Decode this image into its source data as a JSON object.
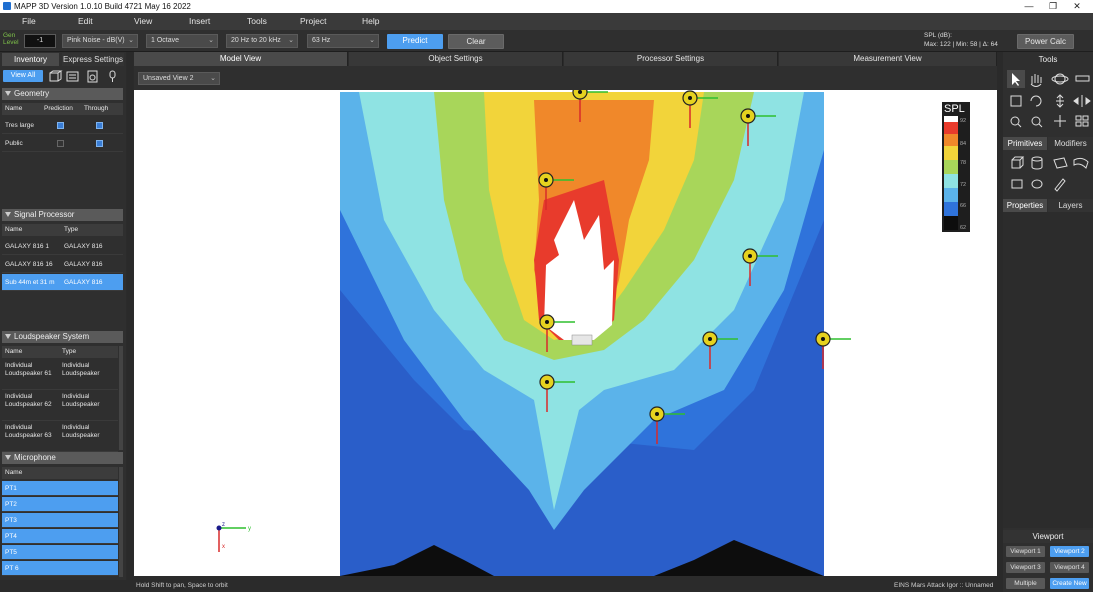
{
  "window": {
    "title": "MAPP 3D Version 1.0.10 Build 4721 May 16 2022",
    "min": "—",
    "restore": "❐",
    "close": "✕"
  },
  "menu": [
    "File",
    "Edit",
    "View",
    "Insert",
    "Tools",
    "Project",
    "Help"
  ],
  "toolbar": {
    "gen_label": "Gen\nLevel",
    "gen_value": "-1",
    "signal": "Pink Noise - dB(V)",
    "octave": "1 Octave",
    "range": "20 Hz to 20 kHz",
    "freq": "63 Hz",
    "predict": "Predict",
    "clear": "Clear",
    "spl_label": "SPL (dB):",
    "spl_stats": "Max: 122 | Min: 58 | Δ: 64",
    "power_calc": "Power Calc"
  },
  "left": {
    "tabs": [
      "Inventory",
      "Express Settings"
    ],
    "view_all": "View All",
    "geometry": {
      "title": "Geometry",
      "headers": [
        "Name",
        "Prediction",
        "Through"
      ],
      "rows": [
        {
          "name": "Tres large",
          "prediction": true,
          "through": true
        },
        {
          "name": "Public",
          "prediction": false,
          "through": true
        }
      ]
    },
    "signal_processor": {
      "title": "Signal Processor",
      "headers": [
        "Name",
        "Type"
      ],
      "rows": [
        {
          "name": "GALAXY 816 1",
          "type": "GALAXY 816"
        },
        {
          "name": "GALAXY 816 16",
          "type": "GALAXY 816"
        },
        {
          "name": "Sub 44m et 31 m",
          "type": "GALAXY 816"
        }
      ]
    },
    "loudspeaker": {
      "title": "Loudspeaker System",
      "headers": [
        "Name",
        "Type"
      ],
      "rows": [
        {
          "name1": "Individual",
          "name2": "Loudspeaker 61",
          "type1": "Individual",
          "type2": "Loudspeaker"
        },
        {
          "name1": "Individual",
          "name2": "Loudspeaker 62",
          "type1": "Individual",
          "type2": "Loudspeaker"
        },
        {
          "name1": "Individual",
          "name2": "Loudspeaker 63",
          "type1": "Individual",
          "type2": "Loudspeaker"
        }
      ]
    },
    "microphone": {
      "title": "Microphone",
      "headers": [
        "Name"
      ],
      "rows": [
        "PT1",
        "PT2",
        "PT3",
        "PT4",
        "PT5",
        "PT 6"
      ]
    }
  },
  "center": {
    "tabs": [
      "Model View",
      "Object Settings",
      "Processor Settings",
      "Measurement View"
    ],
    "view_select": "Unsaved View 2",
    "legend_title": "SPL",
    "legend_ticks": [
      "92",
      "84",
      "78",
      "72",
      "66",
      "62"
    ],
    "axes": {
      "x": "x",
      "y": "y",
      "z": "z"
    },
    "status_left": "Hold Shift to pan, Space to orbit",
    "status_right": "EINS Mars Attack Igor :: Unnamed",
    "colors": {
      "white": "#ffffff",
      "red": "#e83b2c",
      "orange": "#f0882a",
      "yellow": "#f2d43a",
      "green": "#a8d65a",
      "cyan": "#8fe3e3",
      "lightblue": "#5bb3ea",
      "blue": "#2f73db",
      "deepblue": "#2a5ec9"
    }
  },
  "right": {
    "tools_title": "Tools",
    "tabs1": [
      "Primitives",
      "Modifiers"
    ],
    "tabs2": [
      "Properties",
      "Layers"
    ],
    "viewport_title": "Viewport",
    "viewports": [
      "Viewport 1",
      "Viewport 2",
      "Viewport 3",
      "Viewport 4",
      "Multiple",
      "Create New"
    ]
  }
}
